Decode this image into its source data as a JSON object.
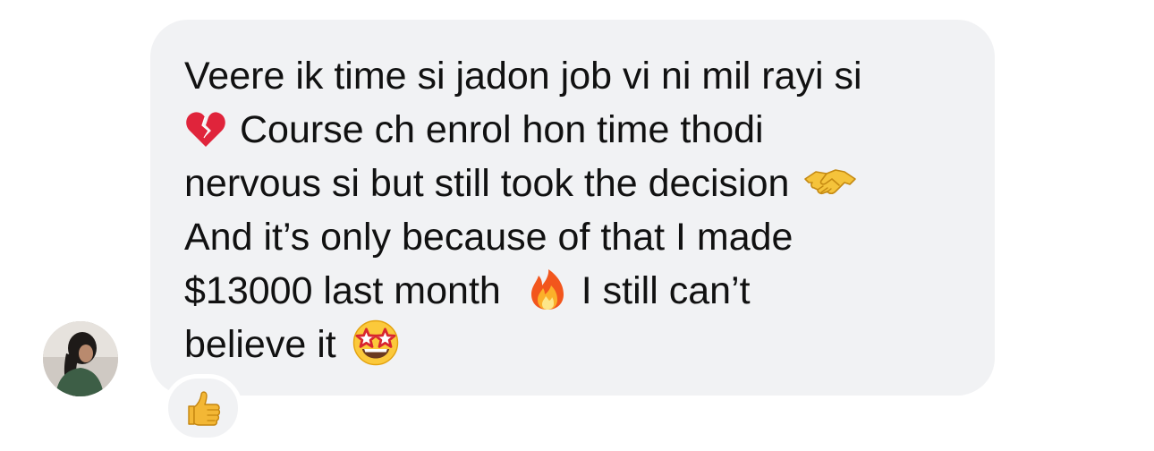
{
  "message": {
    "lines": [
      {
        "before": "Veere ik time si jadon job vi ni mil rayi si",
        "emoji": "",
        "after": ""
      },
      {
        "before": "",
        "emoji": "broken-heart-icon",
        "after": "Course ch enrol hon time thodi"
      },
      {
        "before": "nervous si but still took the decision",
        "emoji": "handshake-icon",
        "after": ""
      },
      {
        "before": "And it’s only because of that I made",
        "emoji": "",
        "after": ""
      },
      {
        "before": "$13000 last month",
        "emoji": "fire-icon",
        "after": "I still can’t"
      },
      {
        "before": "believe it",
        "emoji": "star-struck-icon",
        "after": ""
      }
    ]
  },
  "reaction": {
    "icon": "thumbs-up-icon"
  },
  "avatar": {
    "icon": "user-avatar"
  },
  "colors": {
    "bubble": "#f1f2f4",
    "text": "#111111",
    "background": "#ffffff"
  }
}
